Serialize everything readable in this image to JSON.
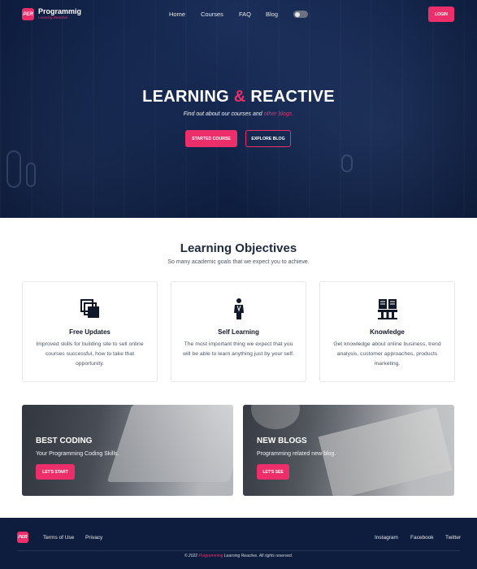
{
  "nav": {
    "logo_badge": "PER",
    "logo_title": "Programmig",
    "logo_subtitle": "Learning Reactive",
    "links": [
      "Home",
      "Courses",
      "FAQ",
      "Blog"
    ],
    "login_label": "LOGIN"
  },
  "hero": {
    "title_part1": "LEARNING",
    "title_amp": "&",
    "title_part2": "REACTIVE",
    "subtitle_prefix": "Find out about our courses and",
    "subtitle_link": "other blogs.",
    "primary_button": "STARTED COURSE",
    "secondary_button": "EXPLORE BLOG"
  },
  "objectives": {
    "title": "Learning Objectives",
    "subtitle": "So many academic goals that we expect you to achieve.",
    "cards": [
      {
        "icon": "copy-icon",
        "title": "Free Updates",
        "text": "Improved skills for building site to sell online courses successful, how to take that opportunity."
      },
      {
        "icon": "person-icon",
        "title": "Self Learning",
        "text": "The most important thing we expect that you will be able to learn anything just by your self."
      },
      {
        "icon": "book-pillar-icon",
        "title": "Knowledge",
        "text": "Get knowledge about online business, trend analysis, customer approaches, products marketing."
      }
    ]
  },
  "promos": [
    {
      "title": "BEST CODING",
      "subtitle": "Your Programming Coding Skills.",
      "button": "LET'S START"
    },
    {
      "title": "NEW BLOGS",
      "subtitle": "Programming related new blog.",
      "button": "LET'S SEE"
    }
  ],
  "footer": {
    "badge": "PER",
    "left_links": [
      "Terms of Use",
      "Privacy"
    ],
    "right_links": [
      "Instagram",
      "Facebook",
      "Twitter"
    ],
    "copyright_prefix": "© 2022",
    "copyright_brand": "Programming",
    "copyright_suffix": "Learning Reactive. All rights reserved."
  },
  "colors": {
    "accent": "#ec2f6b",
    "navy": "#0e1d3e",
    "text_dark": "#1f2a3c"
  }
}
